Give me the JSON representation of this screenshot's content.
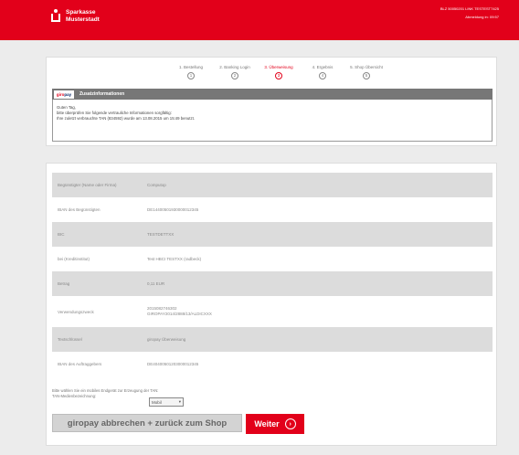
{
  "header": {
    "bank_name_line1": "Sparkasse",
    "bank_name_line2": "Musterstadt",
    "meta_line1": "BLZ 50050201 LINK TESTEST7425",
    "meta_line2": "Abmeldung in: 09:57"
  },
  "steps": [
    {
      "label": "1. Bestellung",
      "num": "①",
      "active": false
    },
    {
      "label": "2. Banking Login",
      "num": "②",
      "active": false
    },
    {
      "label": "3. Überweisung",
      "num": "③",
      "active": true
    },
    {
      "label": "4. Ergebnis",
      "num": "④",
      "active": false
    },
    {
      "label": "5. Shop Übersicht",
      "num": "⑤",
      "active": false
    }
  ],
  "giro": {
    "logo_part1": "giro",
    "logo_part2": "pay",
    "title": "Zusatzinformationen"
  },
  "info": {
    "line1": "Guten Tag,",
    "line2": "bitte überprüfen Sie folgende vertrauliche Informationen sorgfältig:",
    "line3": "Ihre zuletzt verbrauchte TAN (834592) wurde am 13.08.2015 um 15:49 benutzt."
  },
  "table": [
    {
      "key": "Begünstigter (Name oder Firma)",
      "value": "Computop",
      "value2": ""
    },
    {
      "key": "IBAN des Begünstigten",
      "value": "DE14400501930000012345",
      "value2": ""
    },
    {
      "key": "BIC",
      "value": "TESTDETTXX",
      "value2": ""
    },
    {
      "key": "bei (Kreditinstitut)",
      "value": "Test HBCI TESTXX (radbeck)",
      "value2": ""
    },
    {
      "key": "Betrag",
      "value": "0,11 EUR",
      "value2": ""
    },
    {
      "key": "Verwendungszweck",
      "value": "2015082746302",
      "value2": "GIROPAY2014/2888/13/ALDICXXX"
    },
    {
      "key": "Textschlüssel",
      "value": "giropay Überweisung",
      "value2": ""
    },
    {
      "key": "IBAN des Auftraggebers",
      "value": "DE40400501203000012345",
      "value2": ""
    }
  ],
  "tan": {
    "note_line1": "Bitte wählen Sie ein mobiles Endgerät zur Erzeugung der TAN:",
    "note_line2": "TAN-Medienbezeichnung:",
    "selected": "Mobil"
  },
  "buttons": {
    "cancel": "giropay abbrechen + zurück zum Shop",
    "next": "Weiter",
    "next_icon": "›"
  }
}
